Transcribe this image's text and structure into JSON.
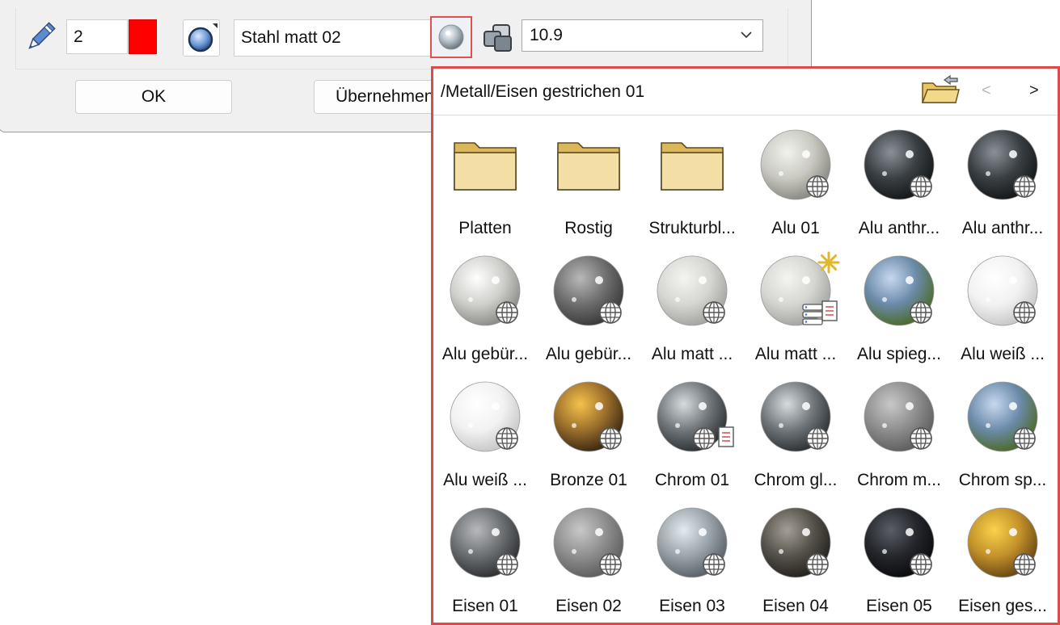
{
  "toolbar": {
    "pen_value": "2",
    "pen_color": "#ff0000",
    "material_name": "Stahl matt 02",
    "layer_value": "10.9",
    "ok_label": "OK",
    "apply_label": "Übernehmen"
  },
  "popup": {
    "path": "/Metall/Eisen gestrichen 01",
    "prev_label": "<",
    "next_label": ">",
    "items": [
      {
        "label": "Platten",
        "kind": "folder"
      },
      {
        "label": "Rostig",
        "kind": "folder"
      },
      {
        "label": "Strukturbl...",
        "kind": "folder"
      },
      {
        "label": "Alu 01",
        "kind": "sphere",
        "style": "matte-silver",
        "badges": [
          "globe"
        ]
      },
      {
        "label": "Alu anthr...",
        "kind": "sphere",
        "style": "dark",
        "badges": [
          "globe"
        ]
      },
      {
        "label": "Alu anthr...",
        "kind": "sphere",
        "style": "dark",
        "badges": [
          "globe"
        ]
      },
      {
        "label": "Alu gebür...",
        "kind": "sphere",
        "style": "light-silver",
        "badges": [
          "globe"
        ]
      },
      {
        "label": "Alu gebür...",
        "kind": "sphere",
        "style": "mid-gray",
        "badges": [
          "globe"
        ]
      },
      {
        "label": "Alu matt ...",
        "kind": "sphere",
        "style": "pale",
        "badges": [
          "globe"
        ]
      },
      {
        "label": "Alu matt ...",
        "kind": "sphere",
        "style": "pale",
        "badges": [
          "star",
          "database",
          "doc"
        ]
      },
      {
        "label": "Alu spieg...",
        "kind": "sphere",
        "style": "env",
        "badges": [
          "globe"
        ]
      },
      {
        "label": "Alu weiß ...",
        "kind": "sphere",
        "style": "white",
        "badges": [
          "globe"
        ]
      },
      {
        "label": "Alu weiß ...",
        "kind": "sphere",
        "style": "white",
        "badges": [
          "globe"
        ]
      },
      {
        "label": "Bronze 01",
        "kind": "sphere",
        "style": "bronze",
        "badges": [
          "globe"
        ]
      },
      {
        "label": "Chrom 01",
        "kind": "sphere",
        "style": "chrome",
        "badges": [
          "globe",
          "doc"
        ]
      },
      {
        "label": "Chrom gl...",
        "kind": "sphere",
        "style": "chrome",
        "badges": [
          "globe"
        ]
      },
      {
        "label": "Chrom m...",
        "kind": "sphere",
        "style": "mid-gray-matte",
        "badges": [
          "globe"
        ]
      },
      {
        "label": "Chrom sp...",
        "kind": "sphere",
        "style": "env",
        "badges": [
          "globe"
        ]
      },
      {
        "label": "Eisen 01",
        "kind": "sphere",
        "style": "iron",
        "badges": [
          "globe"
        ]
      },
      {
        "label": "Eisen 02",
        "kind": "sphere",
        "style": "mid-gray-matte",
        "badges": [
          "globe"
        ]
      },
      {
        "label": "Eisen 03",
        "kind": "sphere",
        "style": "light-steel",
        "badges": [
          "globe"
        ]
      },
      {
        "label": "Eisen 04",
        "kind": "sphere",
        "style": "dark-iron",
        "badges": [
          "globe"
        ]
      },
      {
        "label": "Eisen 05",
        "kind": "sphere",
        "style": "black",
        "badges": [
          "globe"
        ]
      },
      {
        "label": "Eisen ges...",
        "kind": "sphere",
        "style": "gold-rust",
        "badges": [
          "globe"
        ]
      }
    ]
  }
}
